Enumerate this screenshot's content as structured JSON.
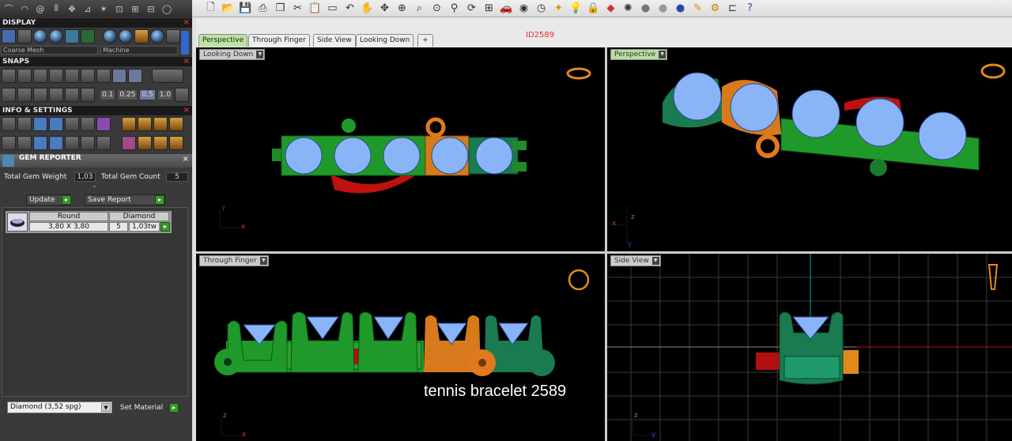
{
  "colors": {
    "accent_green": "#3a9a2a",
    "close_red": "#cc3333",
    "id_red": "#e03030"
  },
  "left_panel": {
    "display": {
      "title": "DISPLAY",
      "mesh_select": "Coarse Mesh",
      "machine_select": "Machine"
    },
    "snaps": {
      "title": "SNAPS",
      "values": [
        "0.1",
        "0.25",
        "0.5",
        "1.0"
      ]
    },
    "info": {
      "title": "INFO & SETTINGS"
    },
    "gem_reporter": {
      "title": "GEM REPORTER",
      "weight_label": "Total Gem Weight",
      "weight_value": "1,03",
      "count_label": "Total Gem Count",
      "count_value": "5",
      "update_label": "Update",
      "save_label": "Save Report",
      "table": {
        "shape": "Round",
        "material": "Diamond",
        "size": "3,80 X 3,80",
        "count": "5",
        "weight": "1,03tw"
      },
      "material_select": "Diamond      (3,52 spg)",
      "set_material_label": "Set Material"
    }
  },
  "tabs": [
    "Perspective",
    "Through Finger",
    "Side View",
    "Looking Down",
    "+"
  ],
  "drawing_id": "ID2589",
  "viewports": {
    "top_left": {
      "label": "Looking Down",
      "axis_x": "x",
      "axis_y": "y"
    },
    "top_right": {
      "label": "Perspective",
      "axis_x": "x",
      "axis_z": "z",
      "axis_y": "y"
    },
    "bottom_left": {
      "label": "Through Finger",
      "axis_x": "x",
      "axis_z": "z"
    },
    "bottom_right": {
      "label": "Side View",
      "axis_y": "y",
      "axis_z": "z"
    }
  },
  "caption": "tennis bracelet 2589",
  "toolbar_icons": [
    "new-icon",
    "open-icon",
    "save-icon",
    "print-icon",
    "copy-icon",
    "cut-icon",
    "paste-icon",
    "clipboard-icon",
    "undo-icon",
    "pan-icon",
    "move-icon",
    "zoom-in-icon",
    "zoom-window-icon",
    "zoom-extents-icon",
    "zoom-icon",
    "rotate-icon",
    "grid-icon",
    "car-icon",
    "eye-icon",
    "clock-icon",
    "render-icon",
    "bulb-icon",
    "lock-icon",
    "material-icon",
    "color-wheel-icon",
    "sphere-icon",
    "sphere-grey-icon",
    "sphere-blue-icon",
    "pen-icon",
    "gear-icon",
    "tree-icon",
    "help-icon"
  ]
}
